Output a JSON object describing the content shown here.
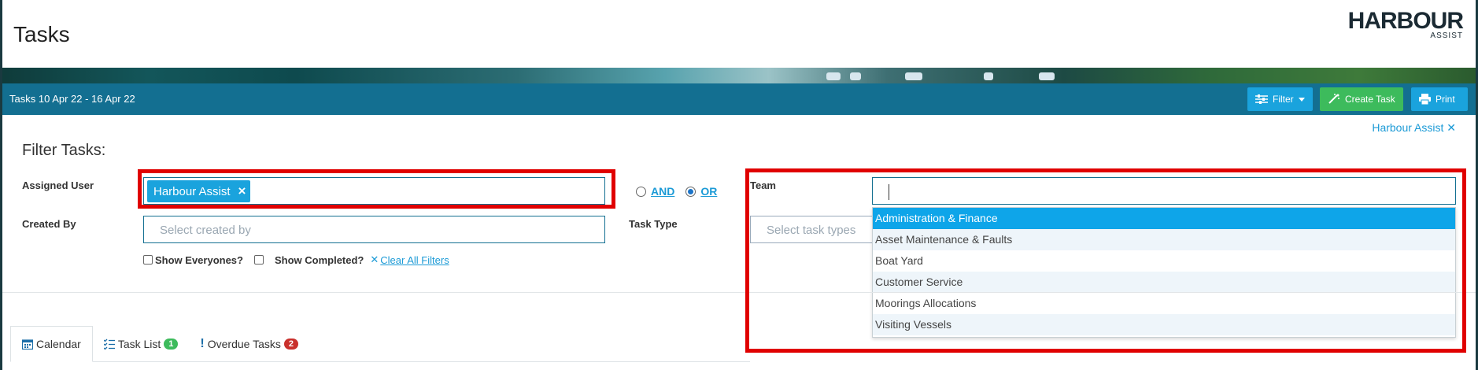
{
  "header": {
    "title": "Tasks",
    "logo_main": "HARBOUR",
    "logo_sub": "ASSIST"
  },
  "toolbar": {
    "title": "Tasks 10 Apr 22 - 16 Apr 22",
    "filter_label": "Filter",
    "create_label": "Create Task",
    "print_label": "Print"
  },
  "filter": {
    "active_user_link": "Harbour Assist",
    "heading": "Filter Tasks:",
    "assigned_user_label": "Assigned User",
    "assigned_user_tag": "Harbour Assist",
    "created_by_label": "Created By",
    "created_by_placeholder": "Select created by",
    "and_label": "AND",
    "or_label": "OR",
    "selected_logic": "OR",
    "task_type_label": "Task Type",
    "task_type_placeholder": "Select task types",
    "team_label": "Team",
    "show_everyones_label": "Show Everyones?",
    "show_completed_label": "Show Completed?",
    "clear_all_label": "Clear All Filters"
  },
  "team_dropdown": {
    "items": [
      "Administration & Finance",
      "Asset Maintenance & Faults",
      "Boat Yard",
      "Customer Service",
      "Moorings Allocations",
      "Visiting Vessels"
    ],
    "highlighted_index": 0
  },
  "tabs": [
    {
      "label": "Calendar",
      "icon": "calendar-icon",
      "active": true
    },
    {
      "label": "Task List",
      "icon": "list-check-icon",
      "badge": "1",
      "badge_color": "#3dbb5c"
    },
    {
      "label": "Overdue Tasks",
      "icon": "exclamation-icon",
      "badge": "2",
      "badge_color": "#c9302c"
    }
  ],
  "colors": {
    "toolbar": "#136f91",
    "primary_button": "#1aa3dd",
    "create_button": "#3dbb5c",
    "highlight": "#e00000"
  }
}
